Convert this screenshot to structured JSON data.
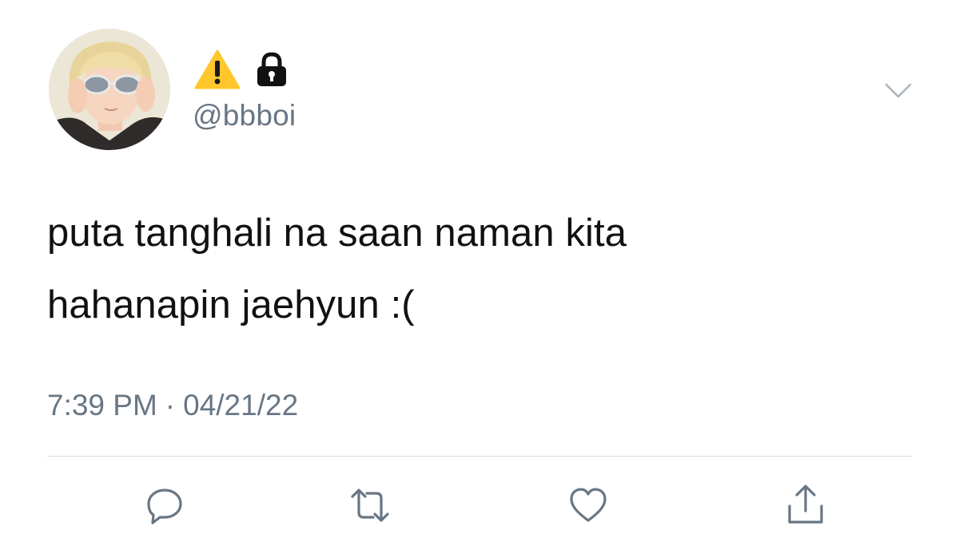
{
  "tweet": {
    "author": {
      "display_name_icons": [
        "warning-icon",
        "lock-icon"
      ],
      "handle": "@bbboi"
    },
    "text": "puta tanghali na saan naman kita\nhahanapin jaehyun :(",
    "time": "7:39 PM",
    "separator": "·",
    "date": "04/21/22"
  },
  "actions": {
    "icons": [
      "reply-icon",
      "retweet-icon",
      "like-icon",
      "share-icon"
    ]
  },
  "colors": {
    "text_primary": "#111111",
    "text_secondary": "#687684",
    "icon": "#687684",
    "divider": "#d7dde2",
    "warning_yellow": "#ffc72c"
  }
}
